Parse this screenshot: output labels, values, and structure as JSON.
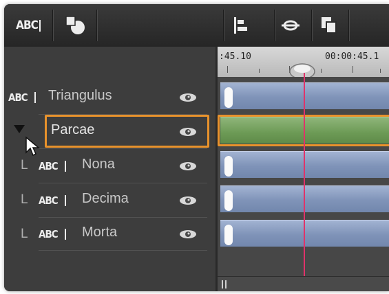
{
  "toolbar": {
    "abc_label": "ABC",
    "icons": [
      "shapes-icon",
      "align-icon",
      "link-icon",
      "copy-icon"
    ]
  },
  "ruler": {
    "start_label": ":45.10",
    "time_label": "00:00:45.1"
  },
  "tracks": [
    {
      "label": "Triangulus",
      "type": "text",
      "indent": false,
      "selected": false
    },
    {
      "label": "Parcae",
      "type": "group",
      "indent": false,
      "selected": true
    },
    {
      "label": "Nona",
      "type": "text",
      "indent": true,
      "selected": false
    },
    {
      "label": "Decima",
      "type": "text",
      "indent": true,
      "selected": false
    },
    {
      "label": "Morta",
      "type": "text",
      "indent": true,
      "selected": false
    }
  ],
  "row_abc": "ABC",
  "indent_glyph": "L",
  "colors": {
    "selection": "#e8922c",
    "playhead": "#e0336a",
    "clip_blue": "#8a9dc0",
    "clip_green": "#6c9a55"
  }
}
